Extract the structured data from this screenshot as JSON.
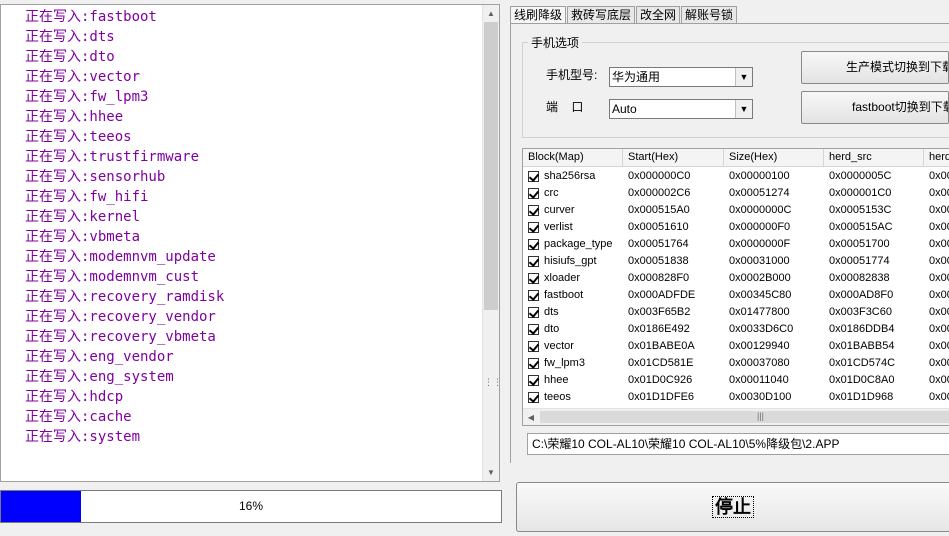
{
  "log": {
    "lines": [
      "正在写入:fastboot",
      "正在写入:dts",
      "正在写入:dto",
      "正在写入:vector",
      "正在写入:fw_lpm3",
      "正在写入:hhee",
      "正在写入:teeos",
      "正在写入:trustfirmware",
      "正在写入:sensorhub",
      "正在写入:fw_hifi",
      "正在写入:kernel",
      "正在写入:vbmeta",
      "正在写入:modemnvm_update",
      "正在写入:modemnvm_cust",
      "正在写入:recovery_ramdisk",
      "正在写入:recovery_vendor",
      "正在写入:recovery_vbmeta",
      "正在写入:eng_vendor",
      "正在写入:eng_system",
      "正在写入:hdcp",
      "正在写入:cache",
      "正在写入:system"
    ]
  },
  "progress": {
    "value": 0.16,
    "label": "16%"
  },
  "tabs": [
    {
      "label": "线刷降级",
      "active": true
    },
    {
      "label": "救砖写底层",
      "active": false
    },
    {
      "label": "改全网",
      "active": false
    },
    {
      "label": "解账号锁",
      "active": false
    }
  ],
  "phone_options": {
    "group_title": "手机选项",
    "model_label": "手机型号:",
    "model_value": "华为通用",
    "port_label": "端    口",
    "port_value": "Auto",
    "btn_production": "生产模式切换到下载",
    "btn_fastboot": "fastboot切换到下载"
  },
  "table": {
    "headers": [
      "Block(Map)",
      "Start(Hex)",
      "Size(Hex)",
      "herd_src",
      "herd"
    ],
    "rows": [
      {
        "block": "sha256rsa",
        "start": "0x000000C0",
        "size": "0x00000100",
        "src": "0x0000005C",
        "last": "0x00"
      },
      {
        "block": "crc",
        "start": "0x000002C6",
        "size": "0x00051274",
        "src": "0x000001C0",
        "last": "0x00"
      },
      {
        "block": "curver",
        "start": "0x000515A0",
        "size": "0x0000000C",
        "src": "0x0005153C",
        "last": "0x00"
      },
      {
        "block": "verlist",
        "start": "0x00051610",
        "size": "0x000000F0",
        "src": "0x000515AC",
        "last": "0x00"
      },
      {
        "block": "package_type",
        "start": "0x00051764",
        "size": "0x0000000F",
        "src": "0x00051700",
        "last": "0x00"
      },
      {
        "block": "hisiufs_gpt",
        "start": "0x00051838",
        "size": "0x00031000",
        "src": "0x00051774",
        "last": "0x00"
      },
      {
        "block": "xloader",
        "start": "0x000828F0",
        "size": "0x0002B000",
        "src": "0x00082838",
        "last": "0x00"
      },
      {
        "block": "fastboot",
        "start": "0x000ADFDE",
        "size": "0x00345C80",
        "src": "0x000AD8F0",
        "last": "0x00"
      },
      {
        "block": "dts",
        "start": "0x003F65B2",
        "size": "0x01477800",
        "src": "0x003F3C60",
        "last": "0x00"
      },
      {
        "block": "dto",
        "start": "0x0186E492",
        "size": "0x0033D6C0",
        "src": "0x0186DDB4",
        "last": "0x00"
      },
      {
        "block": "vector",
        "start": "0x01BABE0A",
        "size": "0x00129940",
        "src": "0x01BABB54",
        "last": "0x00"
      },
      {
        "block": "fw_lpm3",
        "start": "0x01CD581E",
        "size": "0x00037080",
        "src": "0x01CD574C",
        "last": "0x00"
      },
      {
        "block": "hhee",
        "start": "0x01D0C926",
        "size": "0x00011040",
        "src": "0x01D0C8A0",
        "last": "0x00"
      },
      {
        "block": "teeos",
        "start": "0x01D1DFE6",
        "size": "0x0030D100",
        "src": "0x01D1D968",
        "last": "0x00"
      }
    ]
  },
  "path": "C:\\荣耀10 COL-AL10\\荣耀10 COL-AL10\\5%降级包\\2.APP",
  "stop_label": "停止",
  "colors": {
    "log_text": "#8000a0",
    "progress_fill": "#0000ff"
  }
}
